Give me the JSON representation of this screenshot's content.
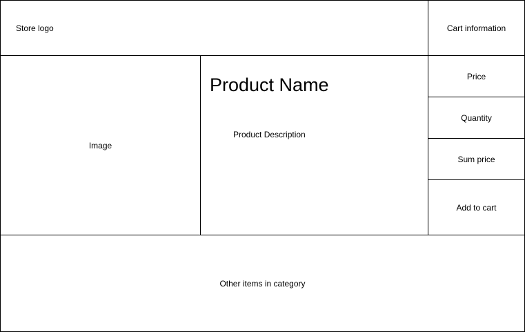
{
  "header": {
    "logo_label": "Store logo",
    "cart_label": "Cart information"
  },
  "main": {
    "image_label": "Image",
    "product_name": "Product Name",
    "product_description": "Product Description"
  },
  "sidebar": {
    "price_label": "Price",
    "quantity_label": "Quantity",
    "sum_label": "Sum price",
    "add_to_cart_label": "Add to cart"
  },
  "footer": {
    "other_items_label": "Other items in category"
  }
}
